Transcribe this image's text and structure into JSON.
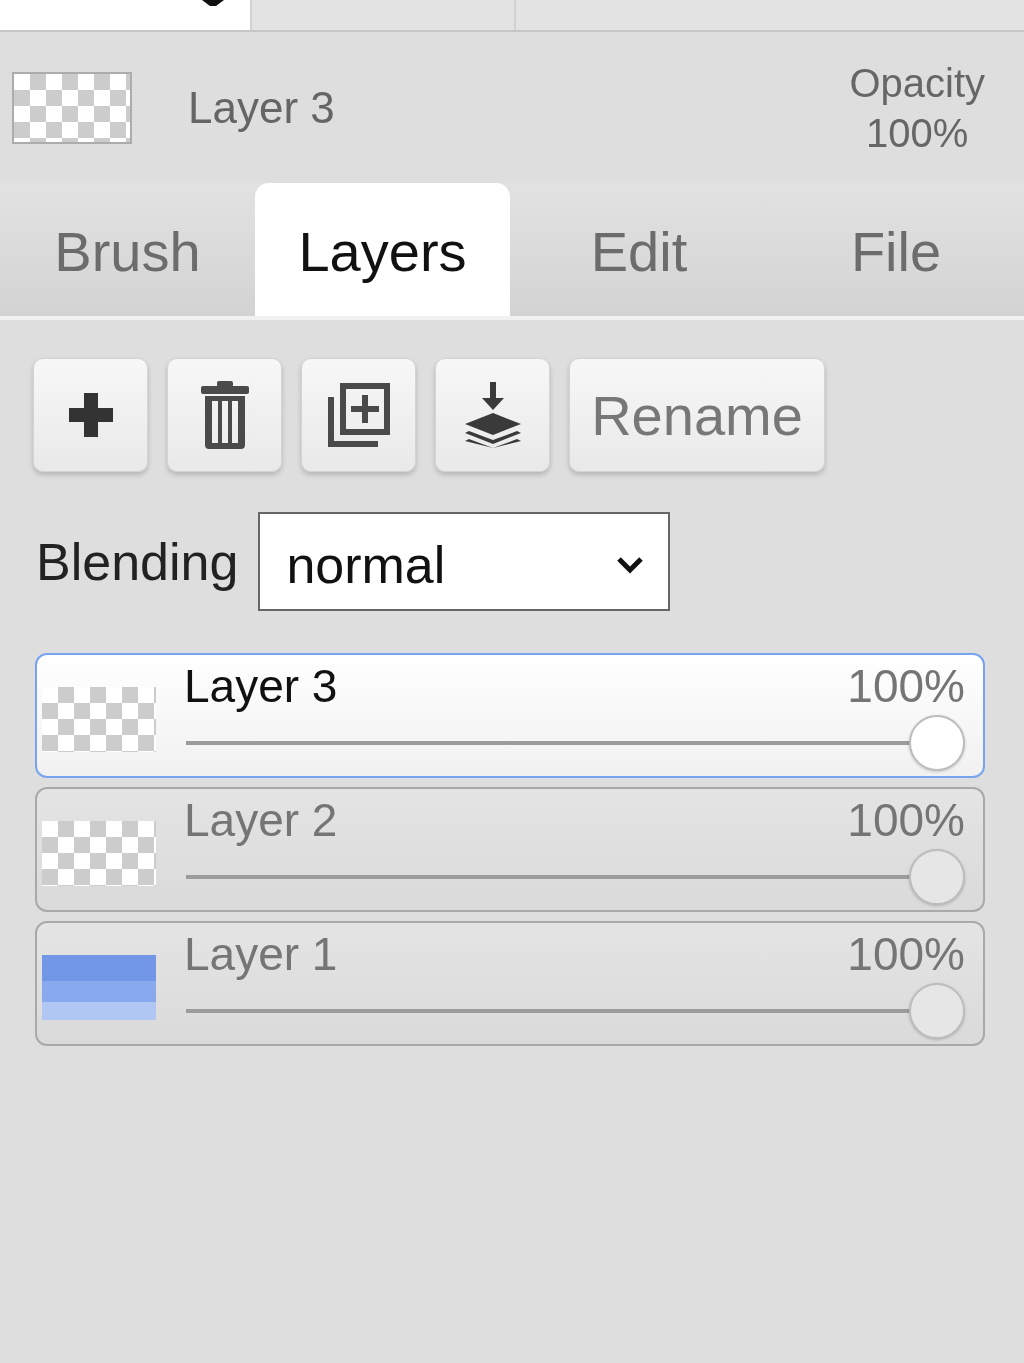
{
  "current_layer": {
    "kind": "transparent",
    "name": "Layer 3",
    "opacity_label": "Opacity",
    "opacity_value": "100%"
  },
  "tabs": [
    {
      "label": "Brush",
      "selected": false
    },
    {
      "label": "Layers",
      "selected": true
    },
    {
      "label": "Edit",
      "selected": false
    },
    {
      "label": "File",
      "selected": false
    }
  ],
  "layer_actions": {
    "rename": "Rename"
  },
  "blending": {
    "label": "Blending",
    "value": "normal"
  },
  "layers": [
    {
      "name": "Layer 3",
      "opacity": "100%",
      "level": 1,
      "selected": true,
      "kind": "transparent"
    },
    {
      "name": "Layer 2",
      "opacity": "100%",
      "level": 1,
      "selected": false,
      "kind": "transparent"
    },
    {
      "name": "Layer 1",
      "opacity": "100%",
      "level": 1,
      "selected": false,
      "kind": "painted"
    }
  ]
}
